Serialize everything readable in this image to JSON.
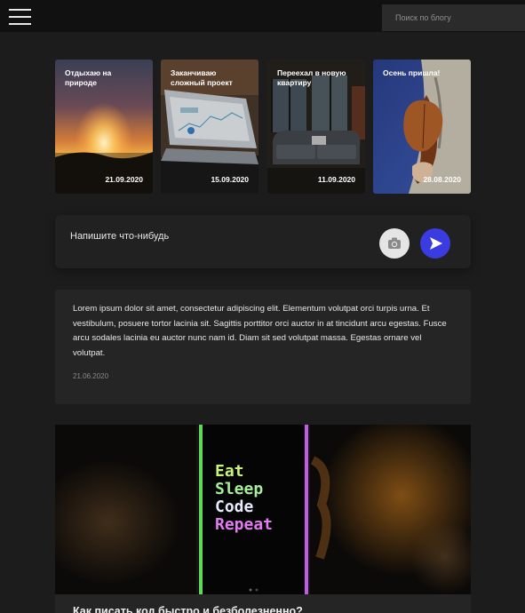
{
  "header": {
    "menu_icon": "hamburger-menu-icon",
    "search_placeholder": "Поиск по блогу"
  },
  "stories": [
    {
      "title": "Отдыхаю на природе",
      "date": "21.09.2020"
    },
    {
      "title": "Заканчиваю сложный проект",
      "date": "15.09.2020"
    },
    {
      "title": "Переехал в новую квартиру",
      "date": "11.09.2020"
    },
    {
      "title": "Осень пришла!",
      "date": "28.08.2020"
    }
  ],
  "composer": {
    "placeholder": "Напишите что-нибудь",
    "camera_icon": "camera-icon",
    "send_icon": "send-icon",
    "send_color": "#3a3be0"
  },
  "post": {
    "text": "Lorem ipsum dolor sit amet, consectetur adipiscing elit. Elementum volutpat orci turpis urna. Et vestibulum, posuere tortor lacinia sit. Sagittis porttitor orci auctor in at tincidunt arcu egestas. Fusce arcu sodales lacinia eu auctor nunc nam id. Diam sit sed volutpat massa. Egestas ornare vel volutpat.",
    "date": "21.06.2020"
  },
  "article": {
    "image_lines": [
      "Eat",
      "Sleep",
      "Code",
      "Repeat"
    ],
    "title": "Как писать код быстро и безболезненно?"
  }
}
